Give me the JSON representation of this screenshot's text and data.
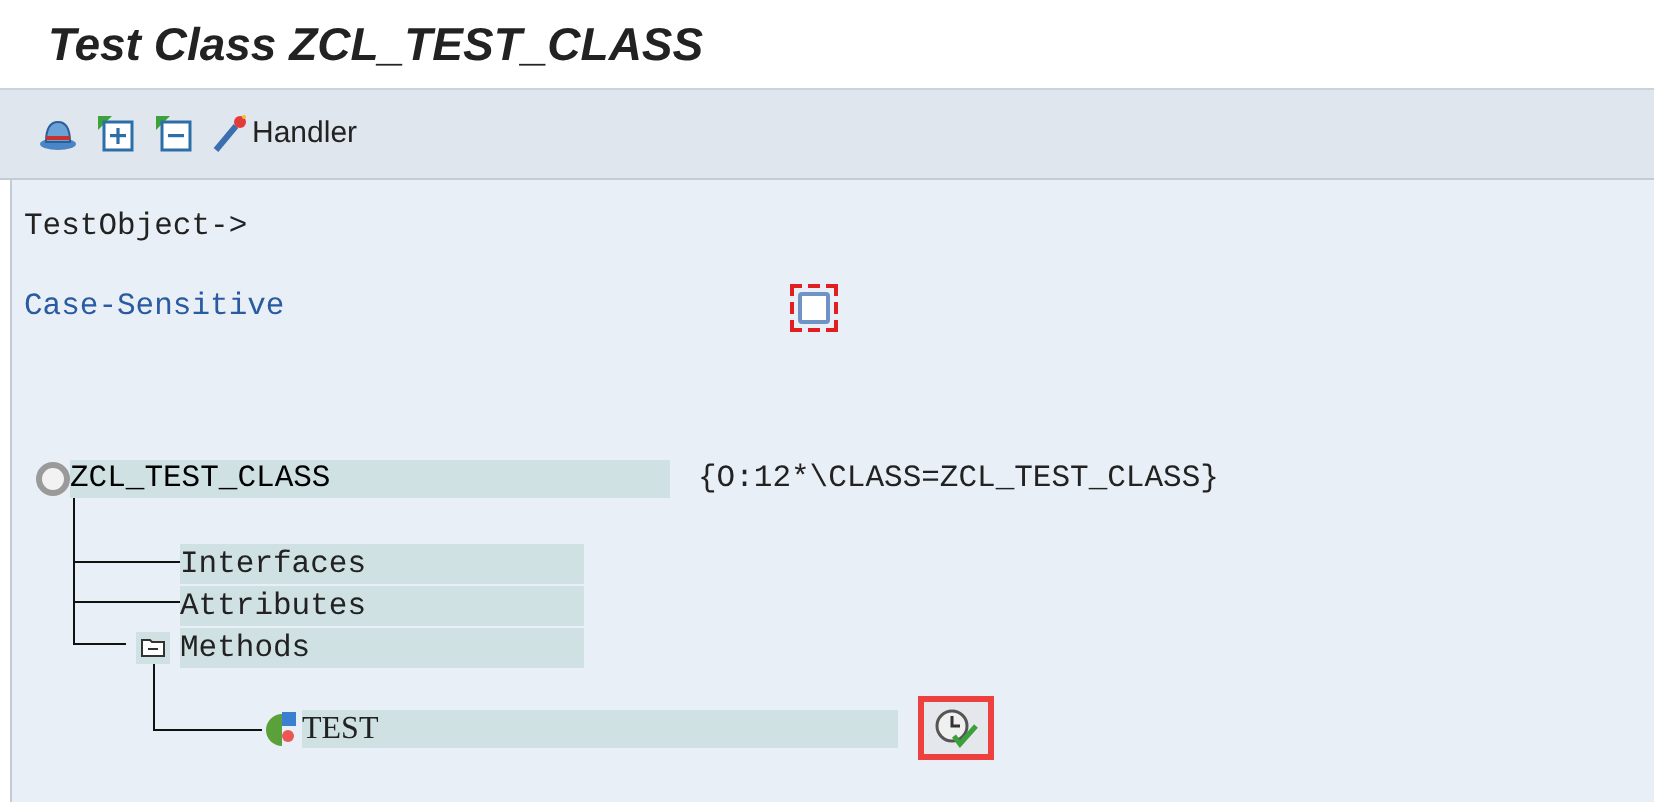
{
  "window": {
    "title": "Test Class ZCL_TEST_CLASS"
  },
  "toolbar": {
    "buttons": [
      {
        "kind": "hat"
      },
      {
        "kind": "expand"
      },
      {
        "kind": "collapse"
      },
      {
        "kind": "wand",
        "label": "Handler"
      }
    ]
  },
  "fields": [
    {
      "label": "TestObject->",
      "kind": "label"
    },
    {
      "label": "Case-Sensitive",
      "kind": "checkbox",
      "checked": false
    }
  ],
  "tree": {
    "label": "ZCL_TEST_CLASS",
    "value": "{O:12*\\CLASS=ZCL_TEST_CLASS}",
    "children": [
      {
        "label": "Interfaces"
      },
      {
        "label": "Attributes"
      },
      {
        "label": "Methods",
        "expanded": true,
        "children": [
          {
            "label": "TEST",
            "passed": true
          }
        ]
      }
    ]
  }
}
